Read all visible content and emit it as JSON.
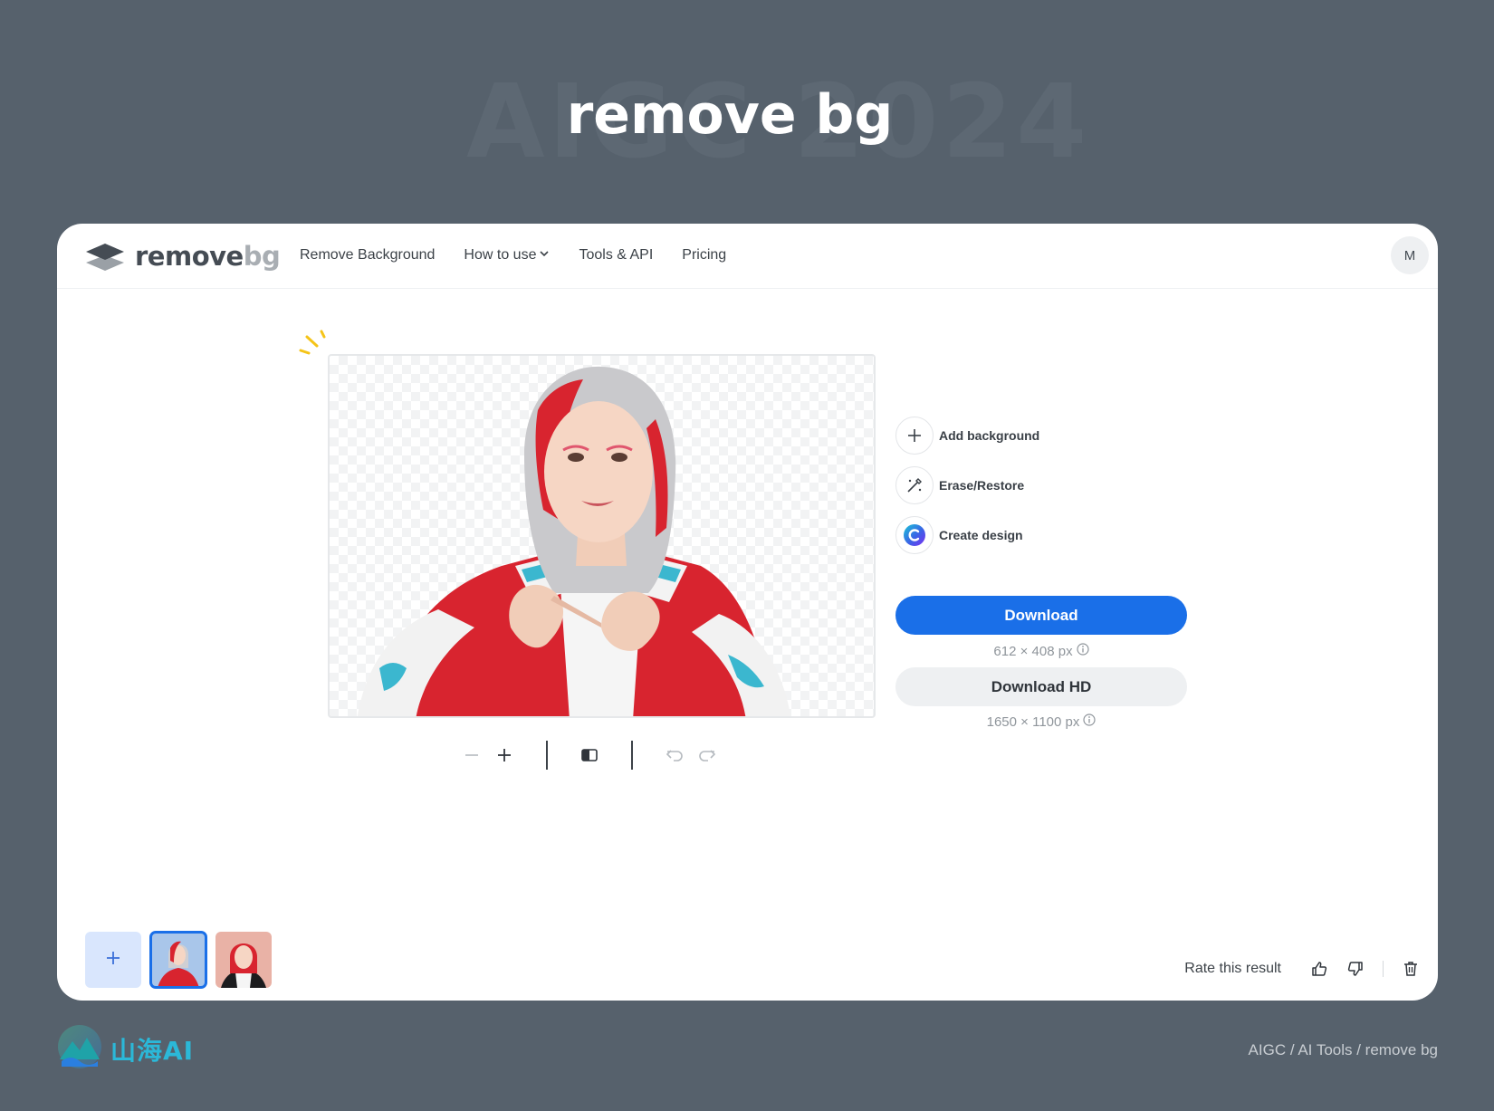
{
  "page": {
    "watermark": "AIGC 2024",
    "heading": "remove bg"
  },
  "nav": {
    "logo_word_1": "remove",
    "logo_word_2": "bg",
    "links": [
      "Remove Background",
      "How to use",
      "Tools & API",
      "Pricing"
    ],
    "avatar_initial": "M"
  },
  "actions": [
    {
      "label": "Add background",
      "icon": "plus-icon"
    },
    {
      "label": "Erase/Restore",
      "icon": "magic-brush-icon"
    },
    {
      "label": "Create design",
      "icon": "canva-logo-icon"
    }
  ],
  "download": {
    "primary_label": "Download",
    "primary_size": "612 × 408 px",
    "hd_label": "Download HD",
    "hd_size": "1650 × 1100 px"
  },
  "toolbar": {
    "icons": [
      "zoom-out-icon",
      "zoom-in-icon",
      "compare-icon",
      "undo-icon",
      "redo-icon"
    ]
  },
  "rating": {
    "label": "Rate this result"
  },
  "footer": {
    "brand": "山海AI",
    "breadcrumb": "AIGC / AI Tools / remove bg"
  },
  "colors": {
    "page_bg": "#56616c",
    "accent": "#1a6fe8",
    "subject_red": "#d8242f"
  }
}
